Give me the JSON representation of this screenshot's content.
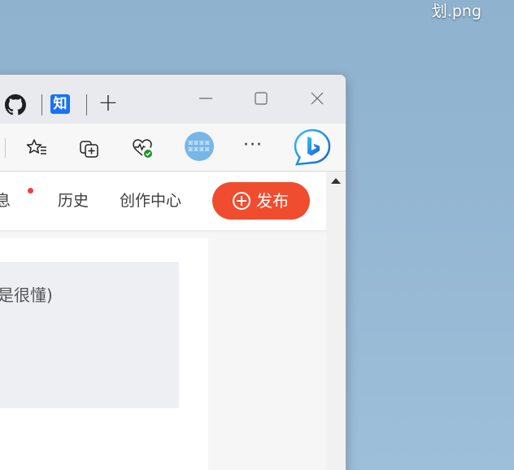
{
  "desktop": {
    "filename_tail": "划.png"
  },
  "browser": {
    "tabs": {
      "zhihu_label": "知",
      "newtab_label": "+"
    },
    "window_controls": {
      "minimize": "—",
      "maximize": "☐",
      "close": "✕"
    },
    "toolbar": {
      "more_label": "···"
    }
  },
  "page": {
    "nav": {
      "messages": "消息",
      "history": "历史",
      "creator_center": "创作中心",
      "publish": "发布"
    },
    "content": {
      "quote_text": "不是很懂)"
    }
  },
  "colors": {
    "publish_button": "#f04d2e",
    "notification_dot": "#f1403c",
    "zhihu_blue": "#1772f6"
  }
}
